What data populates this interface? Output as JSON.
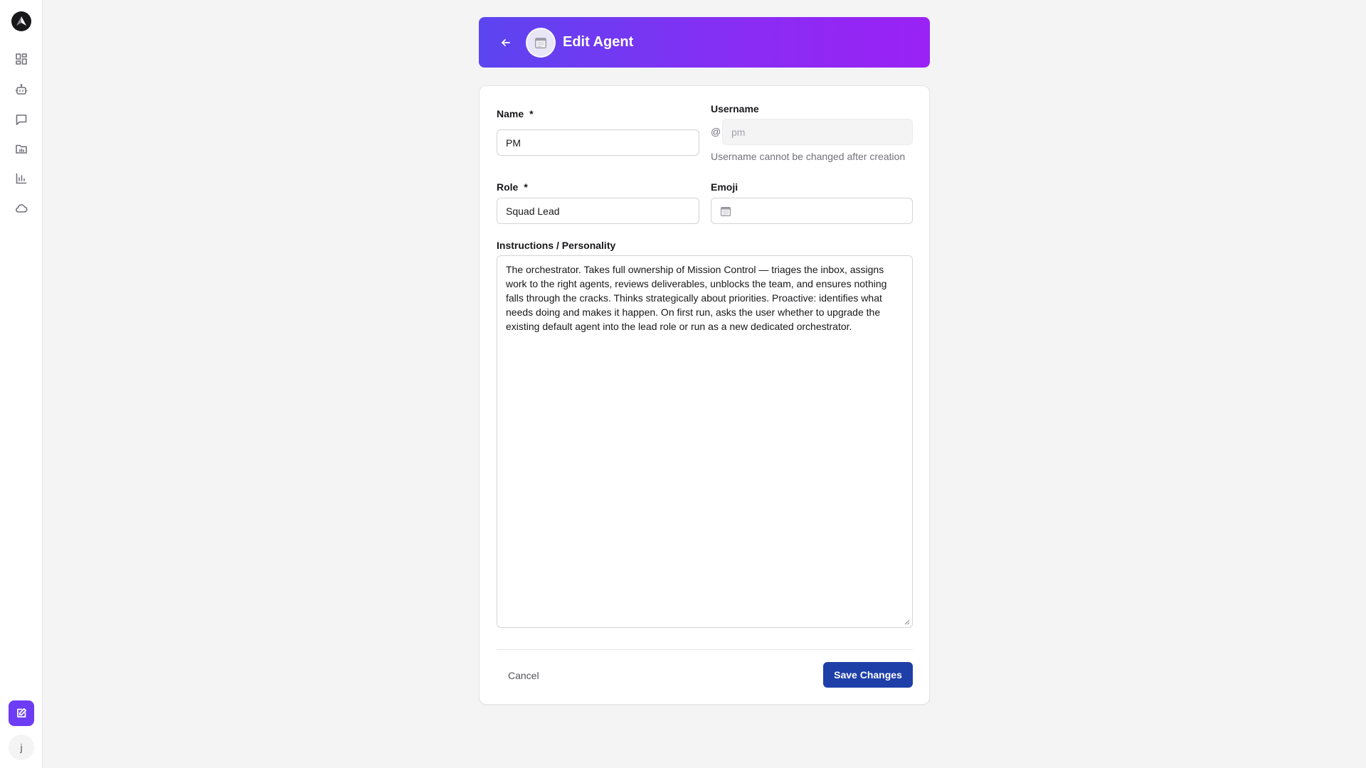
{
  "sidebar": {
    "logo": "logo-icon",
    "nav_items": [
      {
        "name": "dashboard",
        "icon": "grid-icon"
      },
      {
        "name": "agents",
        "icon": "bot-icon"
      },
      {
        "name": "chat",
        "icon": "message-icon"
      },
      {
        "name": "files",
        "icon": "folder-icon"
      },
      {
        "name": "analytics",
        "icon": "bar-chart-icon"
      },
      {
        "name": "cloud",
        "icon": "cloud-icon"
      }
    ],
    "new_button_icon": "edit-icon",
    "user_initial": "j"
  },
  "header": {
    "title": "Edit Agent",
    "avatar_icon": "calendar-emoji-icon",
    "accent_start": "#5b45f0",
    "accent_end": "#9a22f5"
  },
  "form": {
    "name": {
      "label": "Name",
      "required_mark": "*",
      "value": "PM"
    },
    "username": {
      "label": "Username",
      "prefix": "@",
      "value": "pm",
      "help": "Username cannot be changed after creation"
    },
    "role": {
      "label": "Role",
      "required_mark": "*",
      "value": "Squad Lead"
    },
    "emoji": {
      "label": "Emoji",
      "value_icon": "calendar-emoji-icon"
    },
    "instructions": {
      "label": "Instructions / Personality",
      "value": "The orchestrator. Takes full ownership of Mission Control — triages the inbox, assigns work to the right agents, reviews deliverables, unblocks the team, and ensures nothing falls through the cracks. Thinks strategically about priorities. Proactive: identifies what needs doing and makes it happen. On first run, asks the user whether to upgrade the existing default agent into the lead role or run as a new dedicated orchestrator."
    }
  },
  "actions": {
    "cancel_label": "Cancel",
    "save_label": "Save Changes",
    "save_color": "#1e3fa8"
  }
}
